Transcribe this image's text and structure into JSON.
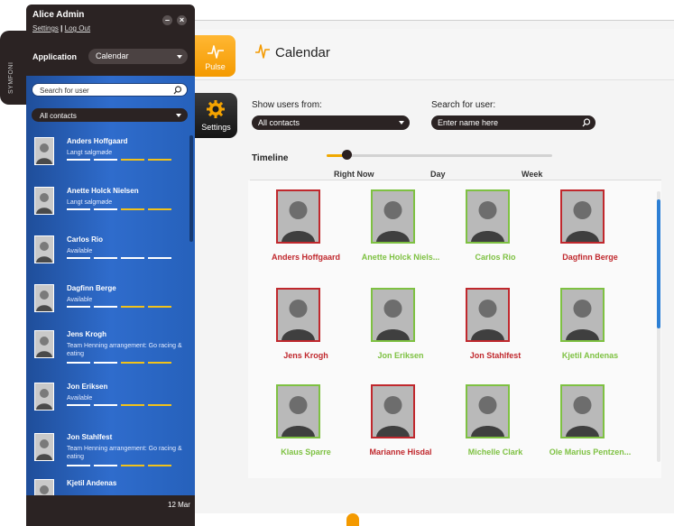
{
  "app": {
    "title": "Calendar",
    "pulse_label": "Pulse",
    "settings_label": "Settings",
    "accent": "#f49a00",
    "red_status": "#c0282d",
    "green_status": "#7ec142"
  },
  "filters": {
    "show_users_label": "Show users from:",
    "show_users_value": "All contacts",
    "search_label": "Search for user:",
    "search_placeholder": "Enter name here",
    "timeline_label": "Timeline",
    "timeline_ticks": [
      "Right Now",
      "Day",
      "Week"
    ],
    "timeline_position": 0.07
  },
  "grid": [
    {
      "name": "Anders Hoffgaard",
      "status": "red"
    },
    {
      "name": "Anette Holck Niels...",
      "status": "green"
    },
    {
      "name": "Carlos Rio",
      "status": "green"
    },
    {
      "name": "Dagfinn Berge",
      "status": "red"
    },
    {
      "name": "Jens Krogh",
      "status": "red"
    },
    {
      "name": "Jon Eriksen",
      "status": "green"
    },
    {
      "name": "Jon Stahlfest",
      "status": "red"
    },
    {
      "name": "Kjetil Andenas",
      "status": "green"
    },
    {
      "name": "Klaus Sparre",
      "status": "green"
    },
    {
      "name": "Marianne Hisdal",
      "status": "red"
    },
    {
      "name": "Michelle Clark",
      "status": "green"
    },
    {
      "name": "Ole Marius Pentzen...",
      "status": "green"
    }
  ],
  "panel": {
    "user_name": "Alice Admin",
    "settings_link": "Settings",
    "separator": "|",
    "logout_link": "Log Out",
    "minimize": "–",
    "close": "×",
    "side_brand": "SYMFONI",
    "application_label": "Application",
    "application_value": "Calendar",
    "search_placeholder": "Search for user",
    "filter_value": "All contacts",
    "date": "12 Mar",
    "contacts": [
      {
        "name": "Anders Hoffgaard",
        "status": "Langt salgmøde",
        "bars": [
          "white",
          "white",
          "yellow",
          "yellow"
        ]
      },
      {
        "name": "Anette Holck Nielsen",
        "status": "Langt salgmøde",
        "bars": [
          "white",
          "white",
          "yellow",
          "yellow"
        ]
      },
      {
        "name": "Carlos Rio",
        "status": "Available",
        "bars": [
          "white",
          "white",
          "white",
          "white"
        ]
      },
      {
        "name": "Dagfinn Berge",
        "status": "Available",
        "bars": [
          "white",
          "white",
          "yellow",
          "yellow"
        ]
      },
      {
        "name": "Jens Krogh",
        "status": "Team Henning arrangement: Go racing & eating",
        "bars": [
          "white",
          "white",
          "yellow",
          "yellow"
        ]
      },
      {
        "name": "Jon Eriksen",
        "status": "Available",
        "bars": [
          "white",
          "white",
          "yellow",
          "yellow"
        ]
      },
      {
        "name": "Jon Stahlfest",
        "status": "Team Henning arrangement: Go racing & eating",
        "bars": [
          "white",
          "white",
          "yellow",
          "yellow"
        ]
      },
      {
        "name": "Kjetil Andenas",
        "status": "",
        "bars": []
      }
    ]
  }
}
